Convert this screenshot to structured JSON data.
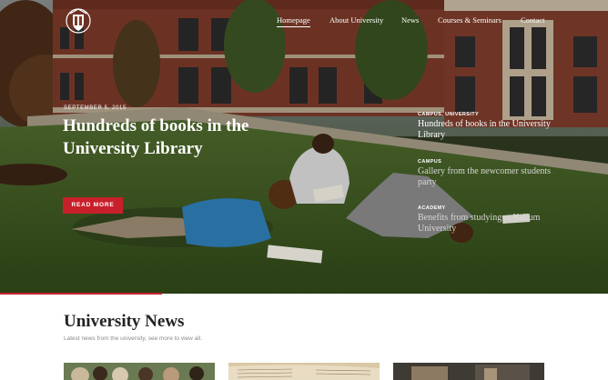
{
  "nav": {
    "items": [
      {
        "label": "Homepage",
        "active": true
      },
      {
        "label": "About University",
        "active": false
      },
      {
        "label": "News",
        "active": false
      },
      {
        "label": "Courses & Seminars",
        "active": false
      },
      {
        "label": "Contact",
        "active": false
      }
    ]
  },
  "hero": {
    "date": "SEPTEMBER 5, 2015",
    "title": "Hundreds of books in the University Library",
    "button_label": "READ MORE"
  },
  "side_news": [
    {
      "category": "CAMPUS, UNIVERSITY",
      "title": "Hundreds of books in the University Library",
      "active": true
    },
    {
      "category": "CAMPUS",
      "title": "Gallery from the newcomer students party",
      "active": false
    },
    {
      "category": "ACADEMY",
      "title": "Benefits from studying at Kalium University",
      "active": false
    }
  ],
  "news": {
    "title": "University News",
    "subtitle": "Latest news from the university, see more to view all."
  },
  "colors": {
    "accent": "#c8202b",
    "grass": "#3f5a22",
    "brick": "#7a3a2a"
  },
  "icons": {
    "logo": "university-crest-icon"
  }
}
